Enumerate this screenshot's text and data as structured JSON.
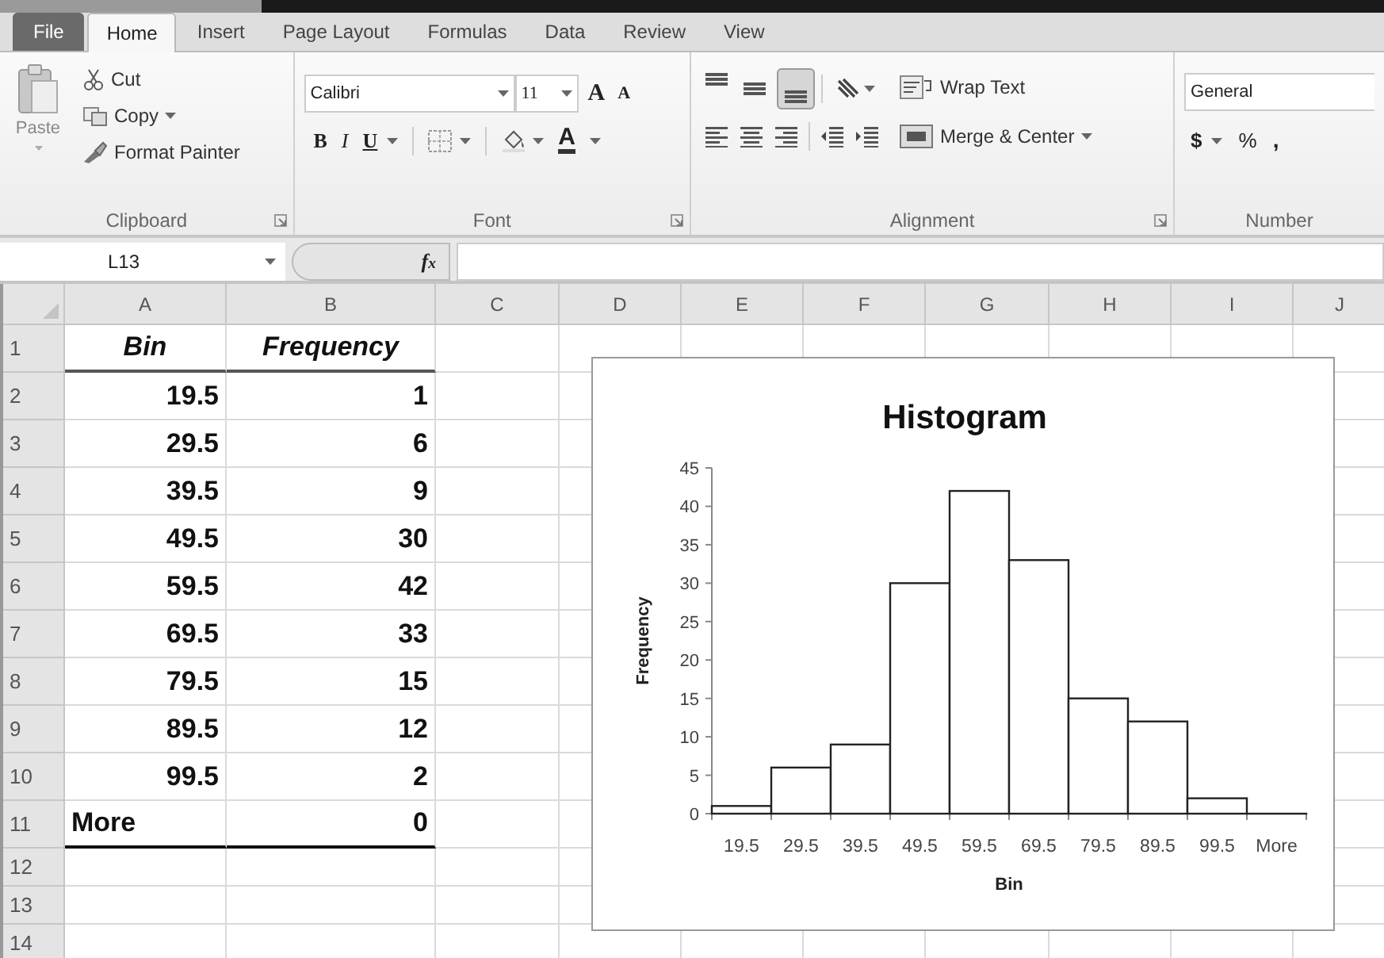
{
  "tabs": [
    {
      "label": "File",
      "kind": "file",
      "selected": false
    },
    {
      "label": "Home",
      "kind": "tab",
      "selected": true
    },
    {
      "label": "Insert",
      "kind": "tab",
      "selected": false
    },
    {
      "label": "Page Layout",
      "kind": "tab",
      "selected": false
    },
    {
      "label": "Formulas",
      "kind": "tab",
      "selected": false
    },
    {
      "label": "Data",
      "kind": "tab",
      "selected": false
    },
    {
      "label": "Review",
      "kind": "tab",
      "selected": false
    },
    {
      "label": "View",
      "kind": "tab",
      "selected": false
    }
  ],
  "ribbon": {
    "clipboard": {
      "paste": "Paste",
      "cut": "Cut",
      "copy": "Copy",
      "format_painter": "Format Painter",
      "label": "Clipboard"
    },
    "font": {
      "name": "Calibri",
      "size": "11",
      "grow": "A",
      "shrink": "A",
      "bold": "B",
      "italic": "I",
      "underline": "U",
      "font_color": "A",
      "label": "Font"
    },
    "alignment": {
      "wrap_text": "Wrap Text",
      "merge_center": "Merge & Center",
      "label": "Alignment"
    },
    "number": {
      "format": "General",
      "currency": "$",
      "percent": "%",
      "comma": ",",
      "label": "Number"
    }
  },
  "formula_bar": {
    "name_box": "L13",
    "function_label": "f$_{x}$"
  },
  "sheet": {
    "columns": [
      "A",
      "B",
      "C",
      "D",
      "E",
      "F",
      "G",
      "H",
      "I",
      "J"
    ],
    "row_numbers": [
      "1",
      "2",
      "3",
      "4",
      "5",
      "6",
      "7",
      "8",
      "9",
      "10",
      "11",
      "12",
      "13",
      "14"
    ],
    "header": [
      "Bin",
      "Frequency"
    ],
    "rows": [
      [
        "19.5",
        "1"
      ],
      [
        "29.5",
        "6"
      ],
      [
        "39.5",
        "9"
      ],
      [
        "49.5",
        "30"
      ],
      [
        "59.5",
        "42"
      ],
      [
        "69.5",
        "33"
      ],
      [
        "79.5",
        "15"
      ],
      [
        "89.5",
        "12"
      ],
      [
        "99.5",
        "2"
      ],
      [
        "More",
        "0"
      ]
    ]
  },
  "chart": {
    "chart_data": {
      "type": "bar",
      "title": "Histogram",
      "xlabel": "Bin",
      "ylabel": "Frequency",
      "categories": [
        "19.5",
        "29.5",
        "39.5",
        "49.5",
        "59.5",
        "69.5",
        "79.5",
        "89.5",
        "99.5",
        "More"
      ],
      "series": [
        {
          "color": "#ffffff",
          "values": [
            1,
            6,
            9,
            30,
            42,
            33,
            15,
            12,
            2,
            0
          ]
        }
      ],
      "ylim": [
        0,
        45
      ],
      "yticks": [
        0,
        5,
        10,
        15,
        20,
        25,
        30,
        35,
        40,
        45
      ]
    }
  }
}
